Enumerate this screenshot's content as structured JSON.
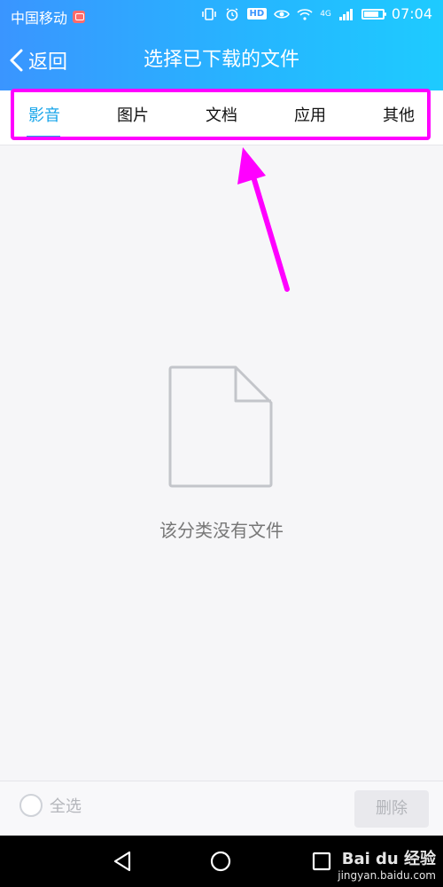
{
  "status_bar": {
    "carrier": "中国移动",
    "network": "4G",
    "hd_label": "HD",
    "battery_level": 0.8,
    "time": "07:04"
  },
  "header": {
    "back_label": "返回",
    "title": "选择已下载的文件",
    "gradient_colors": [
      "#3a95ff",
      "#1ecbff"
    ]
  },
  "tabs": [
    {
      "label": "影音",
      "active": true
    },
    {
      "label": "图片",
      "active": false
    },
    {
      "label": "文档",
      "active": false
    },
    {
      "label": "应用",
      "active": false
    },
    {
      "label": "其他",
      "active": false
    }
  ],
  "accent_color": "#17a5ea",
  "annotation_color": "#ff00ff",
  "empty_state": {
    "icon": "document-icon",
    "text": "该分类没有文件"
  },
  "bottom_bar": {
    "select_all_label": "全选",
    "delete_label": "删除"
  },
  "nav_bar": {
    "icons": [
      "back-triangle-icon",
      "home-circle-icon",
      "recent-square-icon"
    ]
  },
  "watermark": {
    "brand": "Bai du 经验",
    "url": "jingyan.baidu.com"
  }
}
